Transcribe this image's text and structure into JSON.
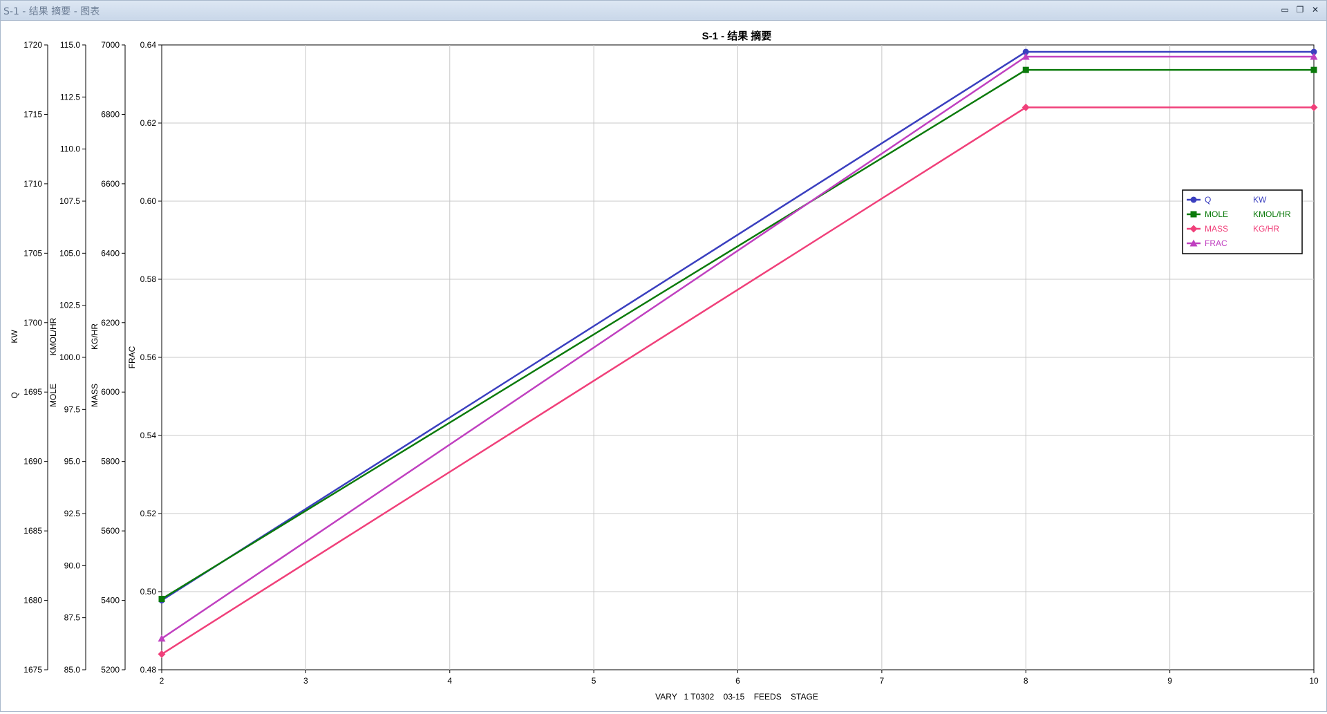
{
  "window": {
    "title": "S-1 - 结果 摘要 - 图表",
    "minimize_glyph": "▭",
    "restore_glyph": "❐",
    "close_glyph": "✕"
  },
  "chart_data": {
    "type": "line",
    "title": "S-1 - 结果 摘要",
    "xlabel": "VARY   1 T0302    03-15    FEEDS    STAGE",
    "x": [
      2,
      8,
      10
    ],
    "xlim": [
      2,
      10
    ],
    "xticks": [
      "2",
      "3",
      "4",
      "5",
      "6",
      "7",
      "8",
      "9",
      "10"
    ],
    "grid": true,
    "legend_position": "top-right",
    "axes": [
      {
        "id": "q",
        "name": "Q",
        "unit": "KW",
        "ylim": [
          1675,
          1720
        ],
        "ticks": [
          "1675",
          "1680",
          "1685",
          "1690",
          "1695",
          "1700",
          "1705",
          "1710",
          "1715",
          "1720"
        ]
      },
      {
        "id": "mole",
        "name": "MOLE",
        "unit": "KMOL/HR",
        "ylim": [
          85,
          115
        ],
        "ticks": [
          "85.0",
          "87.5",
          "90.0",
          "92.5",
          "95.0",
          "97.5",
          "100.0",
          "102.5",
          "105.0",
          "107.5",
          "110.0",
          "112.5",
          "115.0"
        ]
      },
      {
        "id": "mass",
        "name": "MASS",
        "unit": "KG/HR",
        "ylim": [
          5200,
          7000
        ],
        "ticks": [
          "5200",
          "5400",
          "5600",
          "5800",
          "6000",
          "6200",
          "6400",
          "6600",
          "6800",
          "7000"
        ]
      },
      {
        "id": "frac",
        "name": "FRAC",
        "unit": "",
        "ylim": [
          0.48,
          0.64
        ],
        "ticks": [
          "0.48",
          "0.50",
          "0.52",
          "0.54",
          "0.56",
          "0.58",
          "0.60",
          "0.62",
          "0.64"
        ]
      }
    ],
    "series": [
      {
        "name": "Q",
        "unit": "KW",
        "axis": "q",
        "color": "#3a3fbf",
        "marker": "circle",
        "values": [
          1680.0,
          1719.5,
          1719.5
        ]
      },
      {
        "name": "MOLE",
        "unit": "KMOL/HR",
        "axis": "mole",
        "color": "#0b7a0b",
        "marker": "square",
        "values": [
          88.4,
          113.8,
          113.8
        ]
      },
      {
        "name": "MASS",
        "unit": "KG/HR",
        "axis": "mass",
        "color": "#f0407a",
        "marker": "diamond",
        "values": [
          5245,
          6820,
          6820
        ]
      },
      {
        "name": "FRAC",
        "unit": "",
        "axis": "frac",
        "color": "#c040c0",
        "marker": "triangle",
        "values": [
          0.488,
          0.637,
          0.637
        ]
      }
    ]
  }
}
